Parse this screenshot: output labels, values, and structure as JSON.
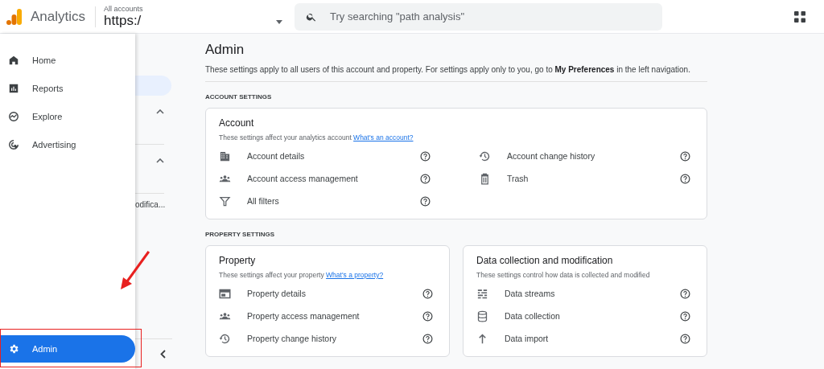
{
  "header": {
    "product": "Analytics",
    "account_label": "All accounts",
    "account_value": "https:/",
    "search": {
      "placeholder": "Try searching \"path analysis\""
    }
  },
  "nav": {
    "items": [
      {
        "label": "Home",
        "kind": "home",
        "selected": false
      },
      {
        "label": "Reports",
        "kind": "reports",
        "selected": false
      },
      {
        "label": "Explore",
        "kind": "explore",
        "selected": false
      },
      {
        "label": "Advertising",
        "kind": "advertising",
        "selected": false
      }
    ],
    "admin": {
      "label": "Admin",
      "selected": true
    }
  },
  "subpanel": {
    "sections": [
      {
        "expanded": true
      },
      {
        "expanded": true
      }
    ],
    "truncated_label": "odifica..."
  },
  "page": {
    "title": "Admin",
    "intro": "These settings apply to all users of this account and property. For settings apply only to you, go to **My Preferences** in the left navigation.",
    "sections": [
      {
        "heading": "ACCOUNT SETTINGS",
        "cards": [
          {
            "title": "Account",
            "description": "These settings affect your analytics account",
            "link": "What's an account?",
            "columns": [
              [
                {
                  "label": "Account details",
                  "kind": "building"
                },
                {
                  "label": "Account access management",
                  "kind": "people"
                },
                {
                  "label": "All filters",
                  "kind": "filter"
                }
              ],
              [
                {
                  "label": "Account change history",
                  "kind": "history"
                },
                {
                  "label": "Trash",
                  "kind": "trash"
                }
              ]
            ]
          }
        ]
      },
      {
        "heading": "PROPERTY SETTINGS",
        "cards": [
          {
            "title": "Property",
            "description": "These settings affect your property",
            "link": "What's a property?",
            "columns": [
              [
                {
                  "label": "Property details",
                  "kind": "card"
                },
                {
                  "label": "Property access management",
                  "kind": "people"
                },
                {
                  "label": "Property change history",
                  "kind": "history"
                }
              ]
            ]
          },
          {
            "title": "Data collection and modification",
            "description": "These settings control how data is collected and modified",
            "columns": [
              [
                {
                  "label": "Data streams",
                  "kind": "streams"
                },
                {
                  "label": "Data collection",
                  "kind": "database"
                },
                {
                  "label": "Data import",
                  "kind": "upload"
                }
              ]
            ]
          }
        ]
      }
    ]
  }
}
